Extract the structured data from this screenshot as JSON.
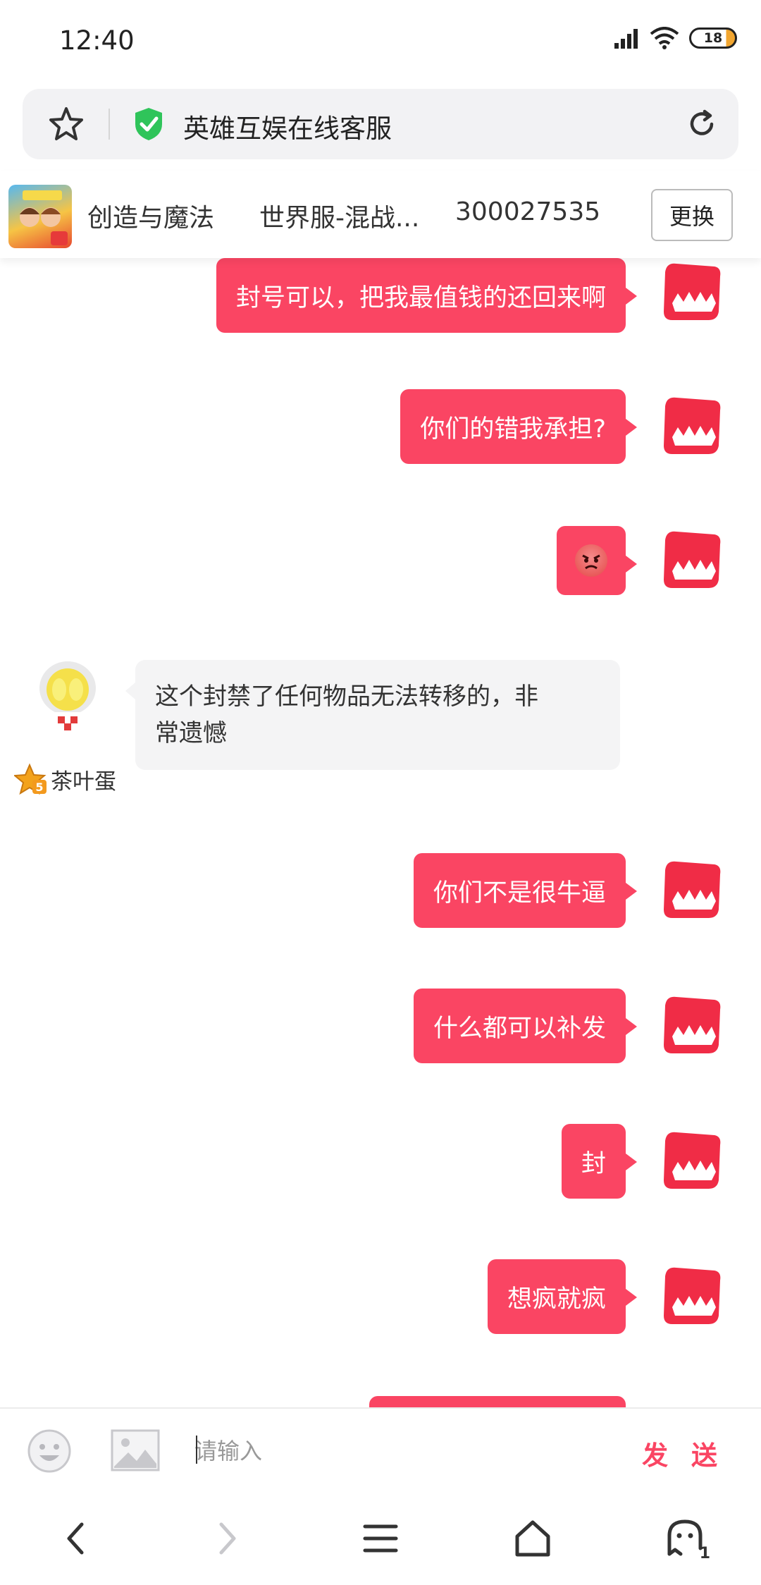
{
  "status": {
    "time": "12:40",
    "battery": "18"
  },
  "address": {
    "title": "英雄互娱在线客服"
  },
  "game": {
    "name": "创造与魔法",
    "server": "世界服-混战...",
    "user_id": "300027535",
    "change_label": "更换"
  },
  "messages": [
    {
      "from": "user",
      "text": "封号可以，把我最值钱的还回来啊"
    },
    {
      "from": "user",
      "text": "你们的错我承担?"
    },
    {
      "from": "user",
      "emoji": "angry-face"
    },
    {
      "from": "agent",
      "name": "茶叶蛋",
      "line1": "这个封禁了任何物品无法转移的，非",
      "line2": "常遗憾"
    },
    {
      "from": "user",
      "text": "你们不是很牛逼"
    },
    {
      "from": "user",
      "text": "什么都可以补发"
    },
    {
      "from": "user",
      "text": "封"
    },
    {
      "from": "user",
      "text": "想疯就疯"
    }
  ],
  "composer": {
    "placeholder": "请输入",
    "send_label": "发 送"
  },
  "nav": {
    "tab_count": "1"
  },
  "colors": {
    "accent": "#fa4563",
    "agent_bubble": "#f4f4f5"
  }
}
